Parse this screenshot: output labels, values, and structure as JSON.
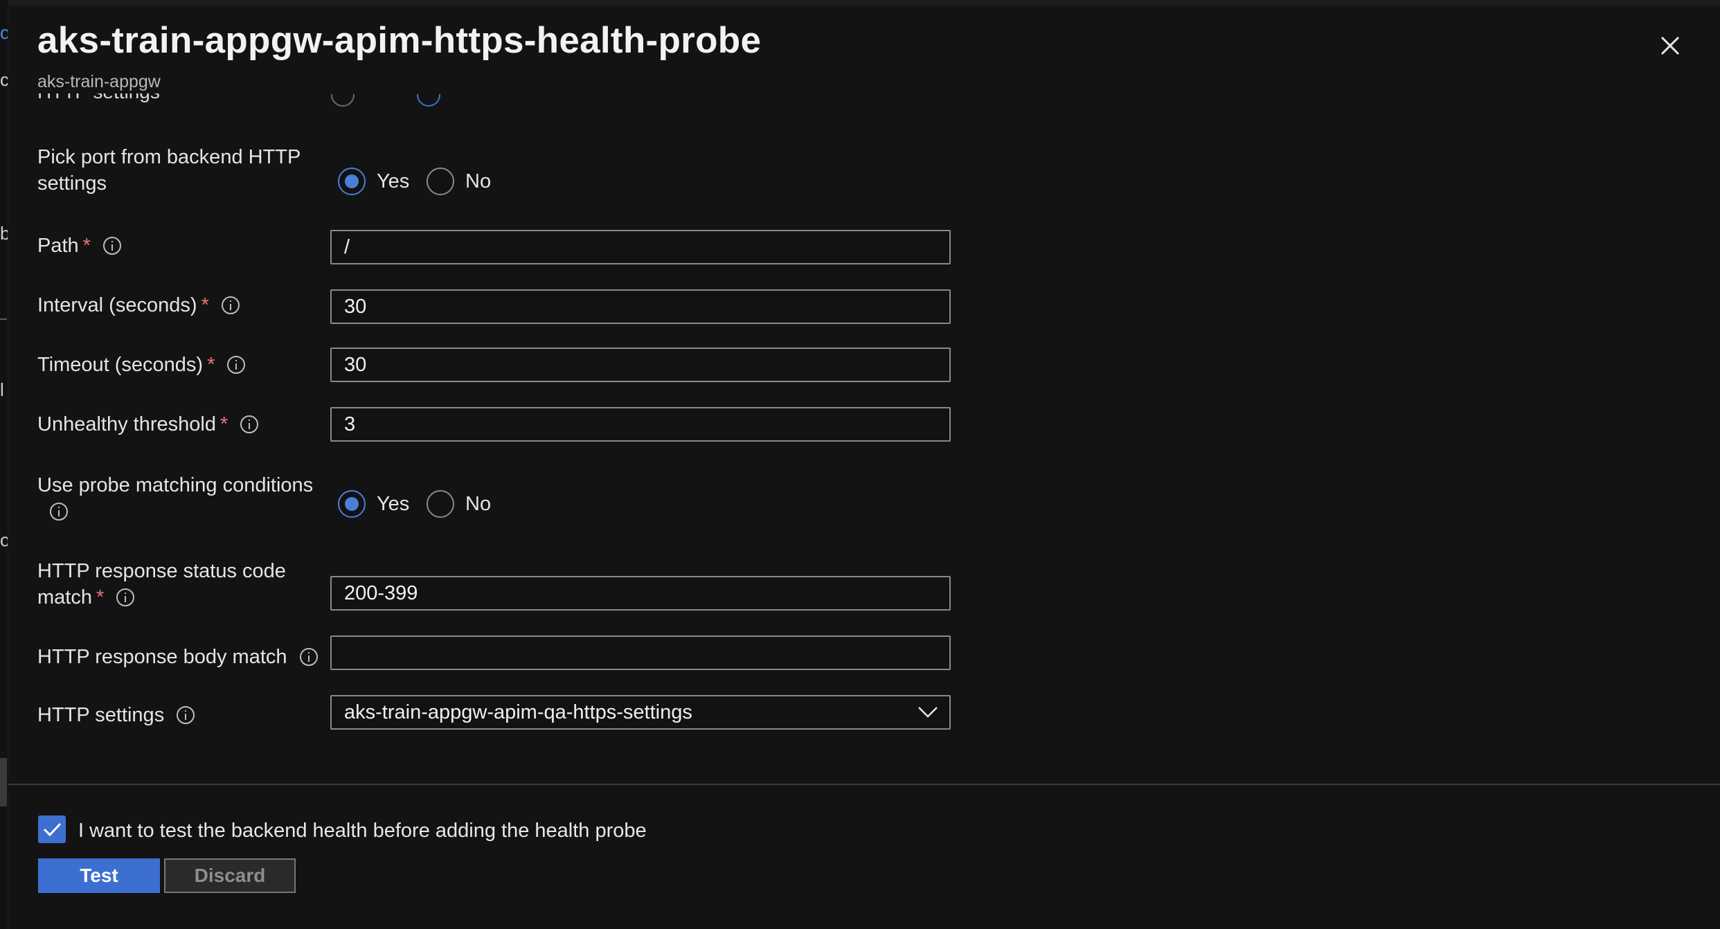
{
  "panel": {
    "title": "aks-train-appgw-apim-https-health-probe",
    "subtitle": "aks-train-appgw",
    "clipped_label": "HTTP settings",
    "close_icon": "close-icon"
  },
  "form": {
    "pick_port": {
      "label_line1": "Pick port from backend HTTP",
      "label_line2": "settings",
      "yes": "Yes",
      "no": "No",
      "selected": "Yes"
    },
    "path": {
      "label": "Path",
      "required": "*",
      "value": "/"
    },
    "interval": {
      "label": "Interval (seconds)",
      "required": "*",
      "value": "30"
    },
    "timeout": {
      "label": "Timeout (seconds)",
      "required": "*",
      "value": "30"
    },
    "unhealthy": {
      "label": "Unhealthy threshold",
      "required": "*",
      "value": "3"
    },
    "probe_matching": {
      "label": "Use probe matching conditions",
      "yes": "Yes",
      "no": "No",
      "selected": "Yes"
    },
    "status_code": {
      "label_line1": "HTTP response status code",
      "label_line2": "match",
      "required": "*",
      "value": "200-399"
    },
    "body_match": {
      "label": "HTTP response body match",
      "value": ""
    },
    "http_settings": {
      "label": "HTTP settings",
      "value": "aks-train-appgw-apim-qa-https-settings"
    }
  },
  "footer": {
    "checkbox_label": "I want to test the backend health before adding the health probe",
    "checkbox_checked": true,
    "test_button": "Test",
    "discard_button": "Discard"
  },
  "colors": {
    "accent": "#3d6fd0",
    "required": "#f1707b",
    "background": "#131313"
  }
}
